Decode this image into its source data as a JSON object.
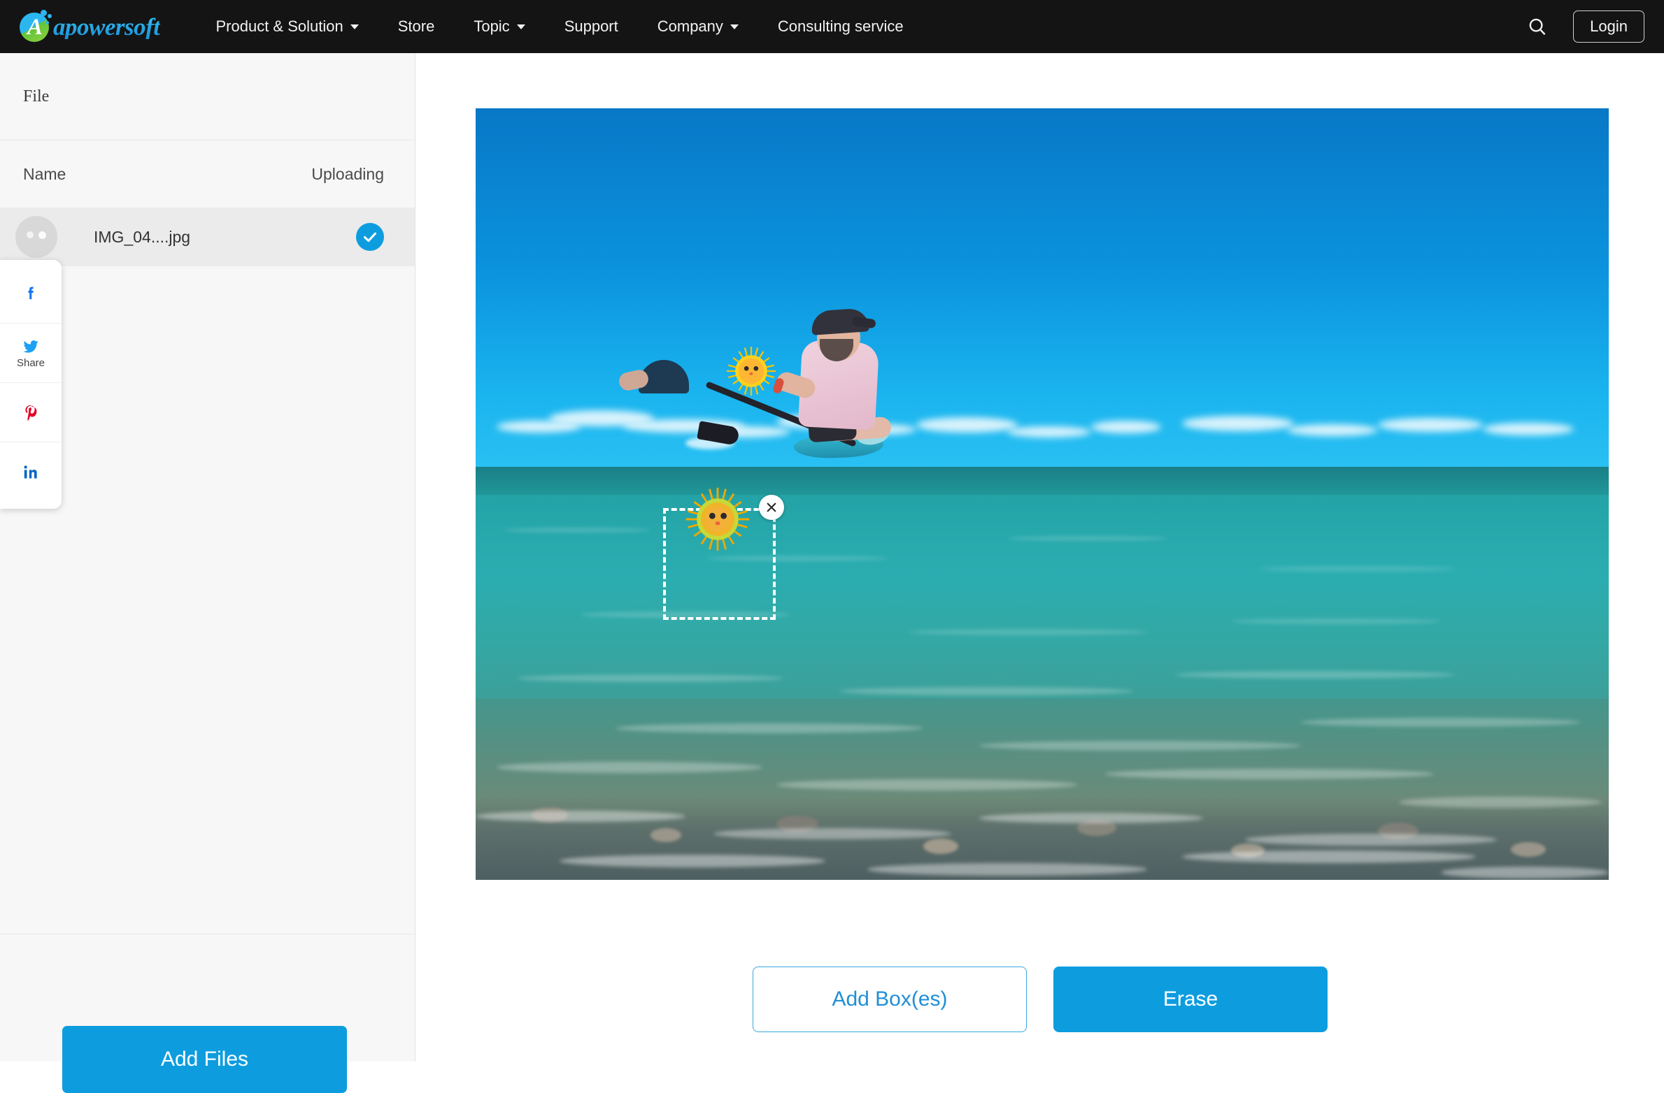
{
  "header": {
    "brand": "apowersoft",
    "nav": [
      {
        "label": "Product & Solution",
        "has_caret": true
      },
      {
        "label": "Store",
        "has_caret": false
      },
      {
        "label": "Topic",
        "has_caret": true
      },
      {
        "label": "Support",
        "has_caret": false
      },
      {
        "label": "Company",
        "has_caret": true
      },
      {
        "label": "Consulting service",
        "has_caret": false
      }
    ],
    "search_icon": "search-icon",
    "login_label": "Login",
    "background": "#141414"
  },
  "sidebar": {
    "title": "File",
    "columns": {
      "name": "Name",
      "status": "Uploading"
    },
    "files": [
      {
        "name": "IMG_04....jpg",
        "status": "uploaded",
        "status_icon": "check-circle-icon"
      }
    ],
    "add_files_label": "Add Files",
    "accent": "#0d9ddf"
  },
  "share_widget": {
    "label": "Share",
    "items": [
      {
        "network": "facebook",
        "icon": "facebook-icon",
        "color": "#1877f2"
      },
      {
        "network": "twitter",
        "icon": "twitter-icon",
        "color": "#1da1f2"
      },
      {
        "network": "pinterest",
        "icon": "pinterest-icon",
        "color": "#e60023"
      },
      {
        "network": "linkedin",
        "icon": "linkedin-icon",
        "color": "#0a66c2"
      }
    ]
  },
  "editor": {
    "photo_alt": "Person paddleboarding on a turquoise sea with sun emoji stickers",
    "selection": {
      "close_icon": "close-icon",
      "style": "dashed"
    },
    "stickers": [
      {
        "type": "sun-emoji",
        "selected": true
      },
      {
        "type": "sun-emoji",
        "selected": false
      }
    ],
    "buttons": {
      "add_boxes": "Add Box(es)",
      "erase": "Erase"
    },
    "accent": "#0d9ddf",
    "outline_accent": "#3aa7e0"
  }
}
